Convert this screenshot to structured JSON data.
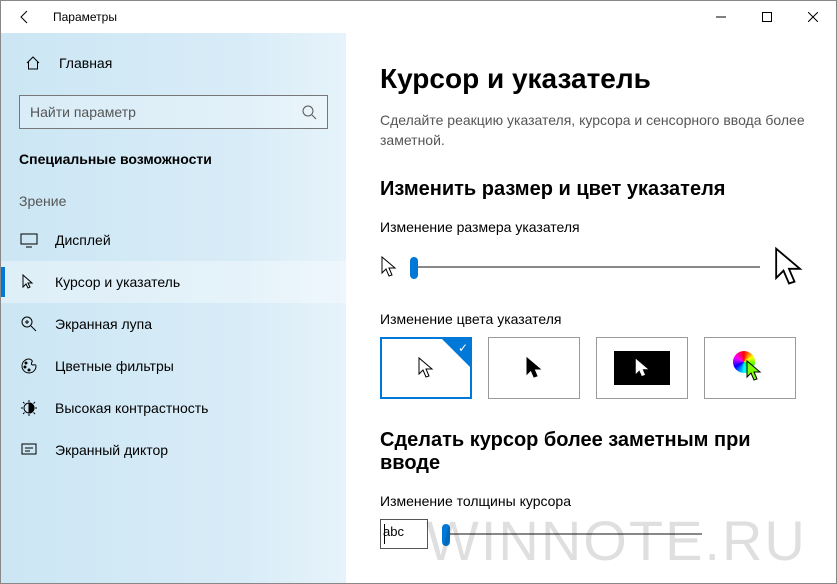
{
  "window": {
    "title": "Параметры"
  },
  "sidebar": {
    "home": "Главная",
    "search_placeholder": "Найти параметр",
    "category": "Специальные возможности",
    "group": "Зрение",
    "items": [
      {
        "label": "Дисплей"
      },
      {
        "label": "Курсор и указатель"
      },
      {
        "label": "Экранная лупа"
      },
      {
        "label": "Цветные фильтры"
      },
      {
        "label": "Высокая контрастность"
      },
      {
        "label": "Экранный диктор"
      }
    ]
  },
  "main": {
    "title": "Курсор и указатель",
    "desc": "Сделайте реакцию указателя, курсора и сенсорного ввода более заметной.",
    "section1": "Изменить размер и цвет указателя",
    "size_label": "Изменение размера указателя",
    "color_label": "Изменение цвета указателя",
    "section2": "Сделать курсор более заметным при вводе",
    "thickness_label": "Изменение толщины курсора",
    "abc": "abc"
  },
  "watermark": "WINNOTE.RU"
}
